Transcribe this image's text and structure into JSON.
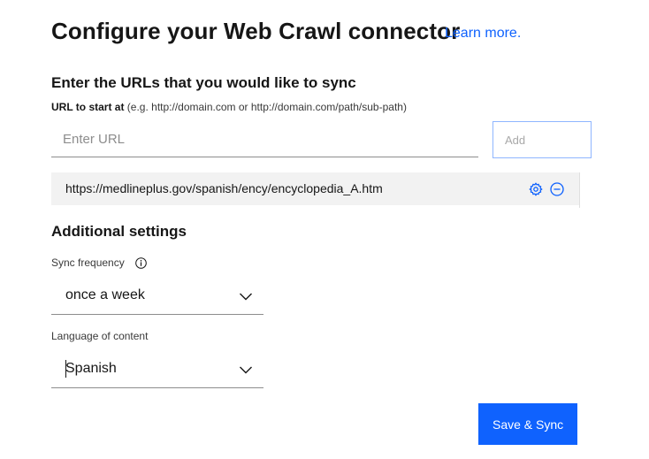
{
  "header": {
    "title": "Configure your Web Crawl connector",
    "learn_more": "Learn more."
  },
  "urls_section": {
    "heading": "Enter the URLs that you would like to sync",
    "label_bold": "URL to start at",
    "label_hint": "(e.g. http://domain.com or http://domain.com/path/sub-path)",
    "input_placeholder": "Enter URL",
    "input_value": "",
    "add_button": "Add",
    "urls": [
      {
        "url": "https://medlineplus.gov/spanish/ency/encyclopedia_A.htm"
      }
    ]
  },
  "additional_settings": {
    "heading": "Additional settings",
    "sync_frequency": {
      "label": "Sync frequency",
      "value": "once a week"
    },
    "language": {
      "label": "Language of content",
      "value": "Spanish"
    }
  },
  "actions": {
    "save_sync": "Save & Sync"
  },
  "colors": {
    "accent": "#0f62fe",
    "text": "#161616",
    "row_background": "#f2f2f2"
  },
  "icons": {
    "row_settings": "gear-icon",
    "row_remove": "minus-circle-icon",
    "sync_info": "info-icon",
    "dropdown": "chevron-down-icon"
  }
}
